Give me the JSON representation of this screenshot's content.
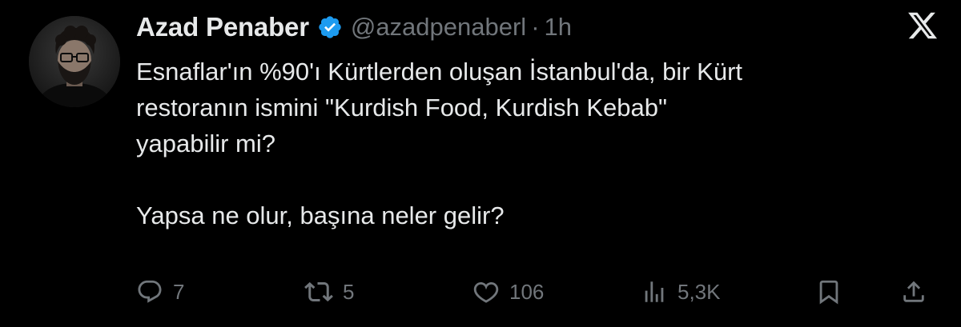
{
  "author": {
    "display_name": "Azad Penaber",
    "handle": "@azadpenaberl",
    "separator": "·",
    "time": "1h",
    "verified": true,
    "verified_color": "#1d9bf0",
    "avatar_icon": "avatar-photo"
  },
  "brand": {
    "logo": "x-logo-icon"
  },
  "tweet": {
    "paragraph1": "Esnaflar'ın %90'ı Kürtlerden oluşan İstanbul'da, bir Kürt\nrestoranın ismini \"Kurdish Food, Kurdish Kebab\"\nyapabilir mi?",
    "paragraph2": "Yapsa ne olur, başına neler gelir?"
  },
  "actions": {
    "reply": {
      "icon": "reply-icon",
      "count": "7"
    },
    "retweet": {
      "icon": "retweet-icon",
      "count": "5"
    },
    "like": {
      "icon": "heart-icon",
      "count": "106"
    },
    "views": {
      "icon": "views-icon",
      "count": "5,3K"
    },
    "bookmark": {
      "icon": "bookmark-icon"
    },
    "share": {
      "icon": "share-icon"
    }
  },
  "colors": {
    "background": "#000000",
    "text": "#e7e9ea",
    "secondary": "#71767b"
  }
}
